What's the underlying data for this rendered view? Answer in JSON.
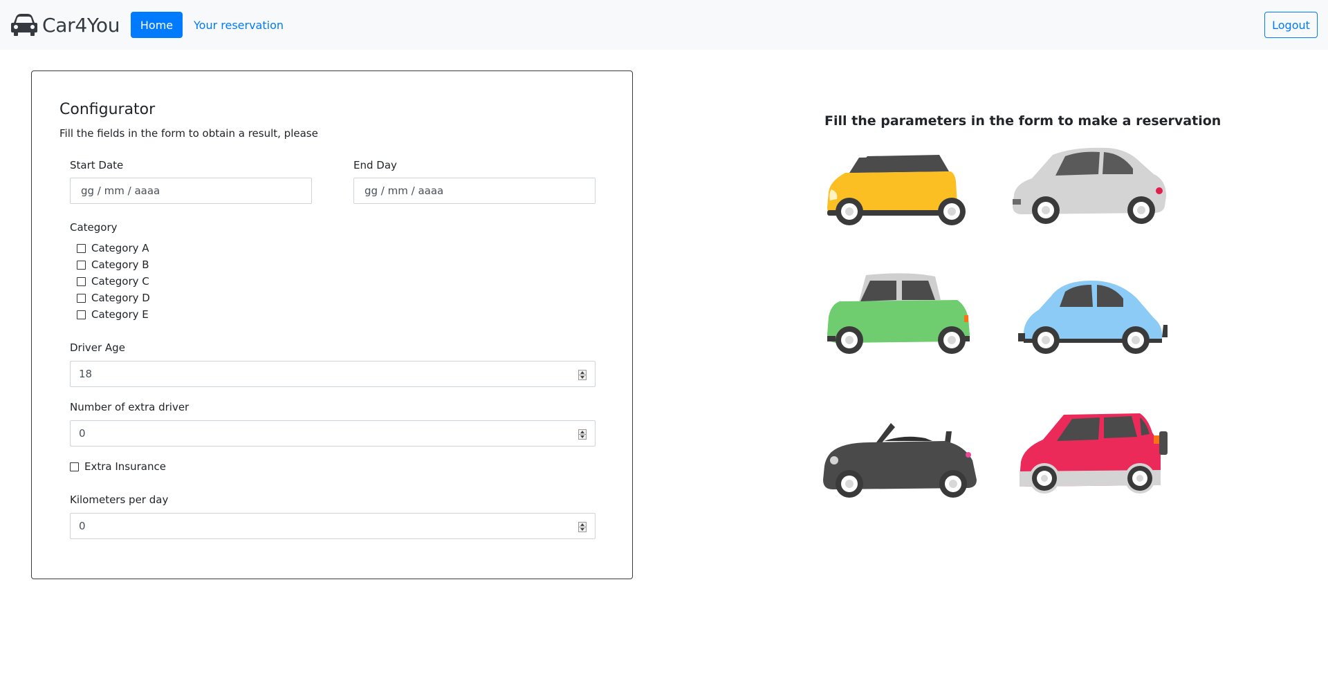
{
  "navbar": {
    "brand": "Car4You",
    "brand_icon": "car-icon",
    "home_label": "Home",
    "reservation_label": "Your reservation",
    "logout_label": "Logout"
  },
  "colors": {
    "primary": "#007bff",
    "navbar_bg": "#f8f9fa"
  },
  "configurator": {
    "title": "Configurator",
    "subtitle": "Fill the fields in the form to obtain a result, please",
    "start_date": {
      "label": "Start Date",
      "placeholder": "gg / mm / aaaa"
    },
    "end_date": {
      "label": "End Day",
      "placeholder": "gg / mm / aaaa"
    },
    "category": {
      "label": "Category",
      "options": [
        "Category A",
        "Category B",
        "Category C",
        "Category D",
        "Category E"
      ]
    },
    "driver_age": {
      "label": "Driver Age",
      "value": "18"
    },
    "extra_drivers": {
      "label": "Number of extra driver",
      "value": "0"
    },
    "extra_insurance": {
      "label": "Extra Insurance"
    },
    "km_per_day": {
      "label": "Kilometers per day",
      "value": "0"
    }
  },
  "right": {
    "heading": "Fill the parameters in the form to make a reservation",
    "cars": [
      {
        "color": "#fbbf24",
        "roof": "#4b4b4b"
      },
      {
        "color": "#d4d4d4",
        "roof": "#d4d4d4"
      },
      {
        "color": "#6fcc6f",
        "roof": "#cfcfcf"
      },
      {
        "color": "#8ccbf5",
        "roof": "#8ccbf5"
      },
      {
        "color": "#4a4a4a",
        "roof": "#4a4a4a"
      },
      {
        "color": "#ec2a5a",
        "roof": "#ec2a5a"
      }
    ]
  }
}
